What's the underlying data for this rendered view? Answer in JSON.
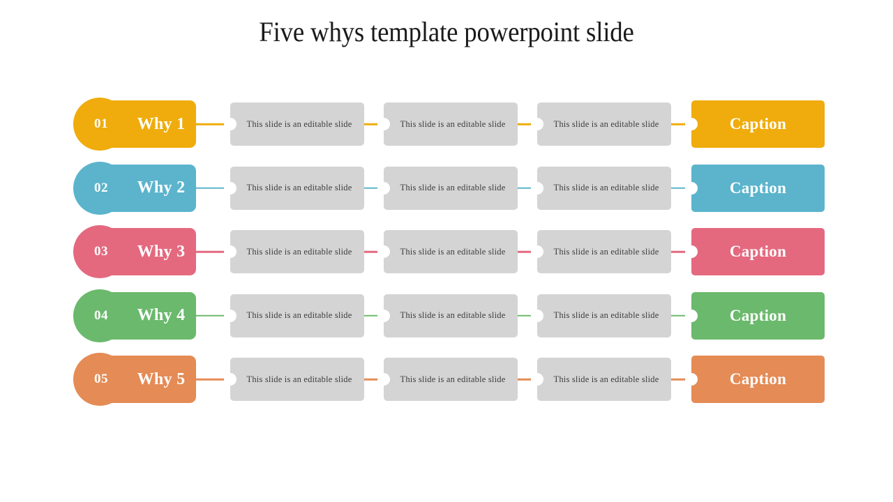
{
  "title": "Five whys template powerpoint slide",
  "rows": [
    {
      "number": "01",
      "label": "Why 1",
      "color": "#EFAC0C",
      "steps": [
        "This slide is an editable slide",
        "This slide is an editable slide",
        "This slide is an editable slide"
      ],
      "caption": "Caption"
    },
    {
      "number": "02",
      "label": "Why 2",
      "color": "#5BB4CC",
      "steps": [
        "This slide is an editable slide",
        "This slide is an editable slide",
        "This slide is an editable slide"
      ],
      "caption": "Caption"
    },
    {
      "number": "03",
      "label": "Why 3",
      "color": "#E4697F",
      "steps": [
        "This slide is an editable slide",
        "This slide is an editable slide",
        "This slide is an editable slide"
      ],
      "caption": "Caption"
    },
    {
      "number": "04",
      "label": "Why 4",
      "color": "#6BB96D",
      "steps": [
        "This slide is an editable slide",
        "This slide is an editable slide",
        "This slide is an editable slide"
      ],
      "caption": "Caption"
    },
    {
      "number": "05",
      "label": "Why 5",
      "color": "#E58B55",
      "steps": [
        "This slide is an editable slide",
        "This slide is an editable slide",
        "This slide is an editable slide"
      ],
      "caption": "Caption"
    }
  ],
  "theme": {
    "background": "#FFFFFF",
    "step_box_fill": "#D4D4D4",
    "step_text_color": "#3D3D3D",
    "title_color": "#1A1A1A",
    "on_color_text": "#FFFFFF"
  }
}
